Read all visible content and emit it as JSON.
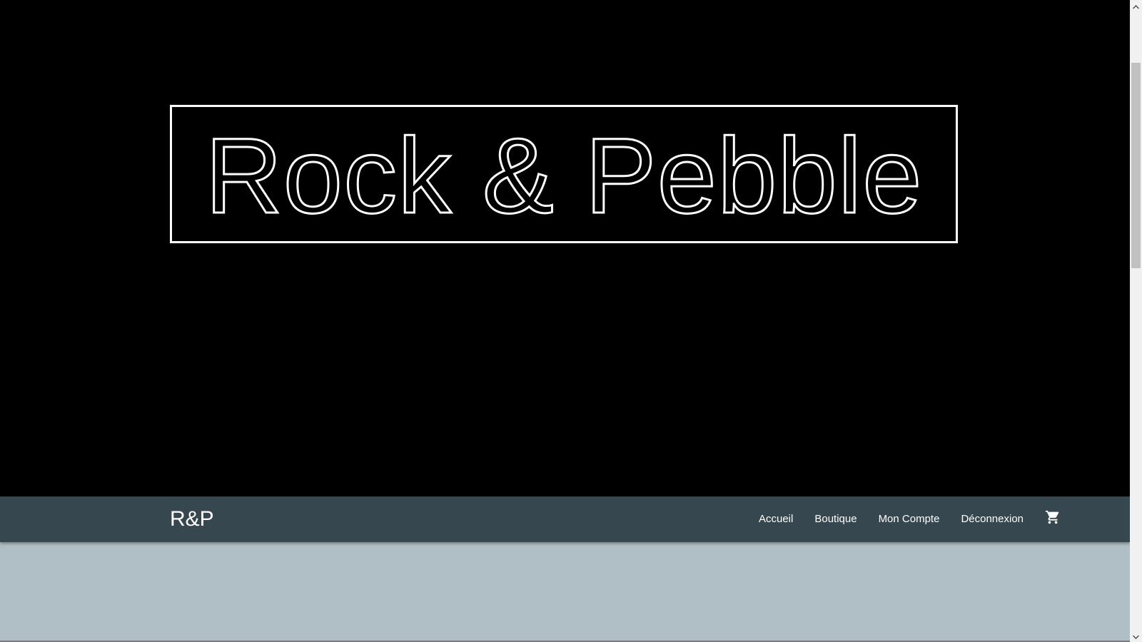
{
  "hero": {
    "title": "Rock & Pebble"
  },
  "navbar": {
    "brand": "R&P",
    "links": [
      {
        "label": "Accueil"
      },
      {
        "label": "Boutique"
      },
      {
        "label": "Mon Compte"
      },
      {
        "label": "Déconnexion"
      }
    ],
    "cart_icon": "shopping-cart-icon"
  },
  "colors": {
    "hero_background": "#000000",
    "hero_outline": "#ffffff",
    "navbar_background": "#37474f",
    "page_background": "#b0bec5"
  },
  "scrollbar": {
    "up_icon": "chevron-up-icon",
    "down_icon": "chevron-down-icon"
  }
}
